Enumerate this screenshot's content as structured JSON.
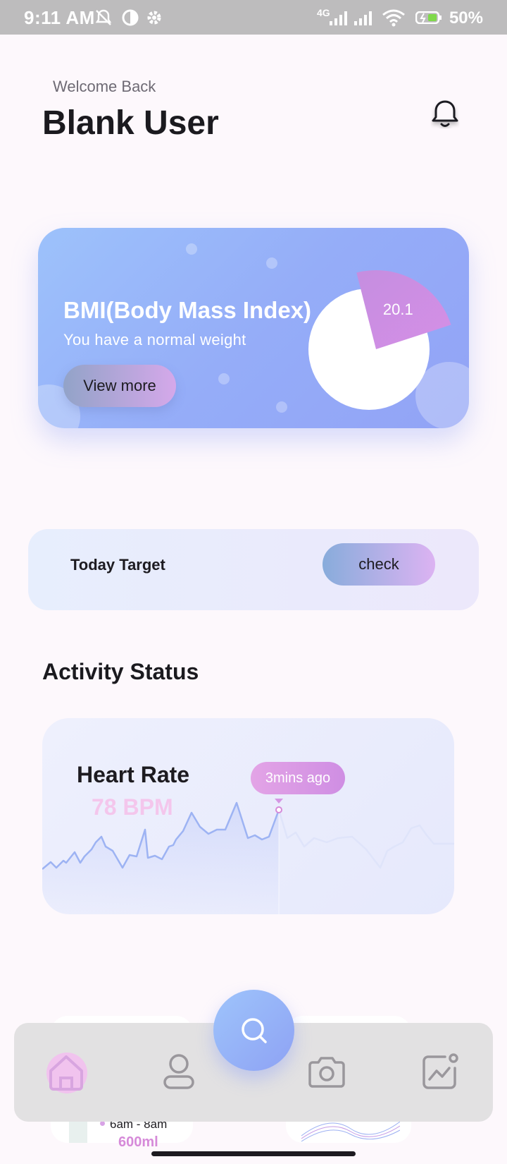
{
  "status_bar": {
    "time": "9:11 AM",
    "network": "4G",
    "battery": "50%"
  },
  "header": {
    "welcome": "Welcome Back",
    "user_name": "Blank User"
  },
  "bmi_card": {
    "title": "BMI(Body Mass Index)",
    "subtitle": "You have a normal weight",
    "button_label": "View more",
    "bmi_value": "20.1",
    "bmi_fraction": 0.2
  },
  "today_target": {
    "label": "Today Target",
    "button_label": "check"
  },
  "activity": {
    "section_title": "Activity Status",
    "heart_rate": {
      "title": "Heart Rate",
      "value": "78 BPM",
      "tooltip": "3mins ago"
    }
  },
  "peek": {
    "time_range": "6am - 8am",
    "amount": "600ml"
  },
  "nav": {
    "items": [
      "home",
      "profile",
      "search",
      "camera",
      "activity"
    ],
    "active": "home"
  },
  "colors": {
    "primary_blue": "#92a3f6",
    "secondary_pink": "#d68ad9",
    "background": "#fdf8fc",
    "status_bar": "#bdbcbd"
  }
}
